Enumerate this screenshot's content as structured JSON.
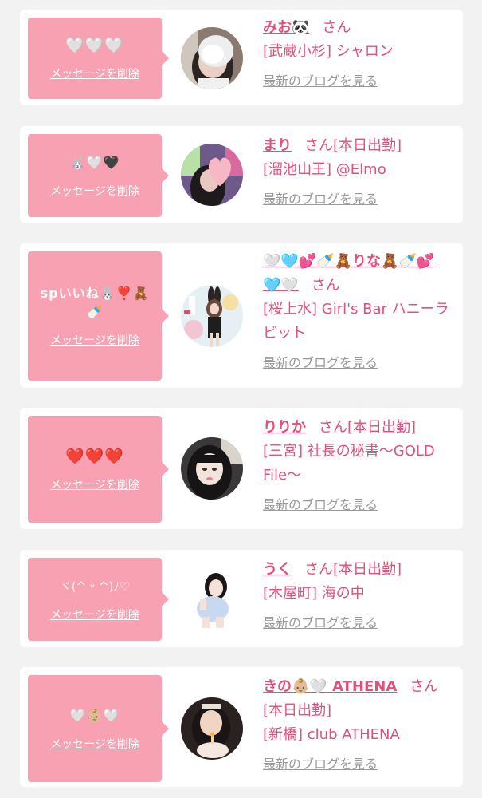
{
  "entries": [
    {
      "message": "🤍🤍🤍",
      "delete_label": "メッセージを削除",
      "name": "みお🐼",
      "suffix": "さん",
      "status": "",
      "area": "[武蔵小杉]",
      "shop": "シャロン",
      "blog_link": "最新のブログを見る"
    },
    {
      "message": "🐰🤍🖤",
      "delete_label": "メッセージを削除",
      "name": "まり",
      "suffix": "さん",
      "status": "[本日出勤]",
      "area": "[溜池山王]",
      "shop": "@Elmo",
      "blog_link": "最新のブログを見る"
    },
    {
      "message": "spいいね🐰❣️🧸🍼",
      "delete_label": "メッセージを削除",
      "name": "🤍🩵💕🍼🧸りな🧸🍼💕🩵🤍",
      "suffix": "さん",
      "status": "",
      "area": "[桜上水]",
      "shop": "Girl's Bar ハニーラビット",
      "blog_link": "最新のブログを見る"
    },
    {
      "message": "❤️❤️❤️",
      "delete_label": "メッセージを削除",
      "name": "りりか",
      "suffix": "さん",
      "status": "[本日出勤]",
      "area": "[三宮]",
      "shop": "社長の秘書〜GOLD File〜",
      "blog_link": "最新のブログを見る"
    },
    {
      "message": "ヾ(^ ᵕ ^)ﾉ♡",
      "delete_label": "メッセージを削除",
      "name": "うく",
      "suffix": "さん",
      "status": "[本日出勤]",
      "area": "[木屋町]",
      "shop": "海の中",
      "blog_link": "最新のブログを見る"
    },
    {
      "message": "🤍👶🏼🤍",
      "delete_label": "メッセージを削除",
      "name": "きの👶🏼🤍 ATHENA",
      "suffix": "さん",
      "status": "[本日出勤]",
      "area": "[新橋]",
      "shop": "club ATHENA",
      "blog_link": "最新のブログを見る"
    }
  ],
  "colors": {
    "accent": "#e0507a",
    "bubble": "#f7a1b3",
    "link_gray": "#999999",
    "background": "#f2f2f2"
  }
}
